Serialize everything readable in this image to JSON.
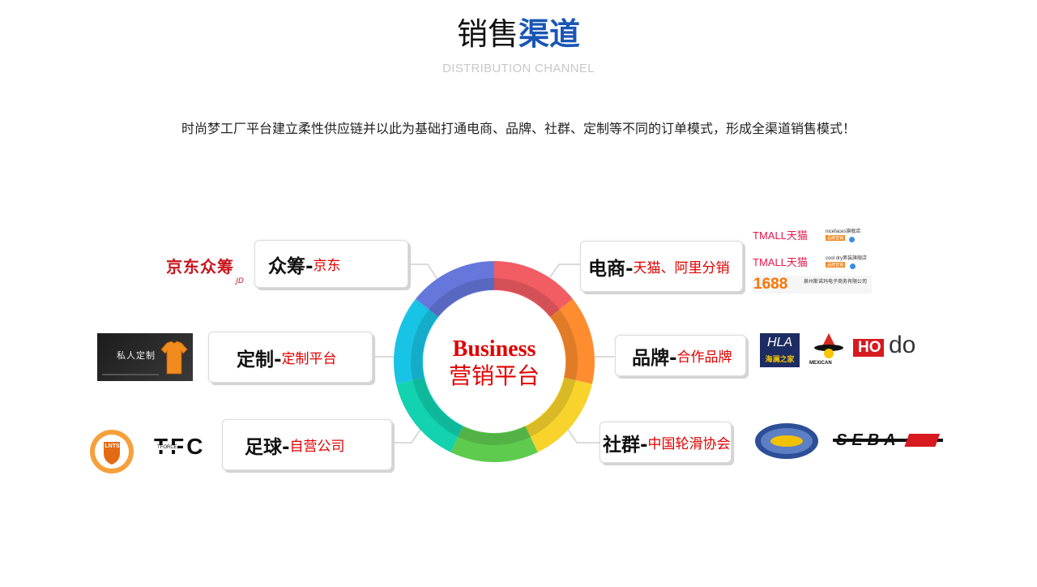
{
  "header": {
    "title_plain": "销售",
    "title_accent": "渠道",
    "subtitle": "DISTRIBUTION CHANNEL",
    "description": "时尚梦工厂平台建立柔性供应链并以此为基础打通电商、品牌、社群、定制等不同的订单模式，形成全渠道销售模式！"
  },
  "center": {
    "line1": "Business",
    "line2": "营销平台",
    "ring_colors": [
      "#f25c63",
      "#ff8c2e",
      "#f7d32c",
      "#5ecb4f",
      "#12d2b0",
      "#18c4e6",
      "#6577db"
    ]
  },
  "channels": {
    "crowdfunding": {
      "main": "众筹-",
      "sub": "京东",
      "logo": "京东众筹",
      "logo_sub": "JD"
    },
    "custom": {
      "main": "定制-",
      "sub": "定制平台",
      "thumb_text": "私人定制"
    },
    "football": {
      "main": "足球-",
      "sub": "自营公司",
      "logo_lnts": "LNTS",
      "logo_tfc": "TFC",
      "logo_tfc_sub": "TFORCE"
    },
    "ecommerce": {
      "main": "电商-",
      "sub": "天猫、阿里分销",
      "logos": [
        {
          "brand": "TMALL天猫",
          "shop": "nicefaces旗舰店",
          "tag": "品牌直销"
        },
        {
          "brand": "TMALL天猫",
          "shop": "cool dry男装旗舰店",
          "tag": "品牌直销"
        },
        {
          "brand": "1688",
          "shop": "泉州斯诺玛电子商务有限公司"
        }
      ]
    },
    "brand": {
      "main": "品牌-",
      "sub": "合作品牌",
      "logo_hla": "HLA",
      "logo_hla_sub": "海澜之家",
      "logo_mex": "MEXICAN",
      "logo_hodo": "HO",
      "logo_hodo_tail": "do"
    },
    "community": {
      "main": "社群-",
      "sub": "中国轮滑协会",
      "logo_seba": "SEBA"
    }
  }
}
